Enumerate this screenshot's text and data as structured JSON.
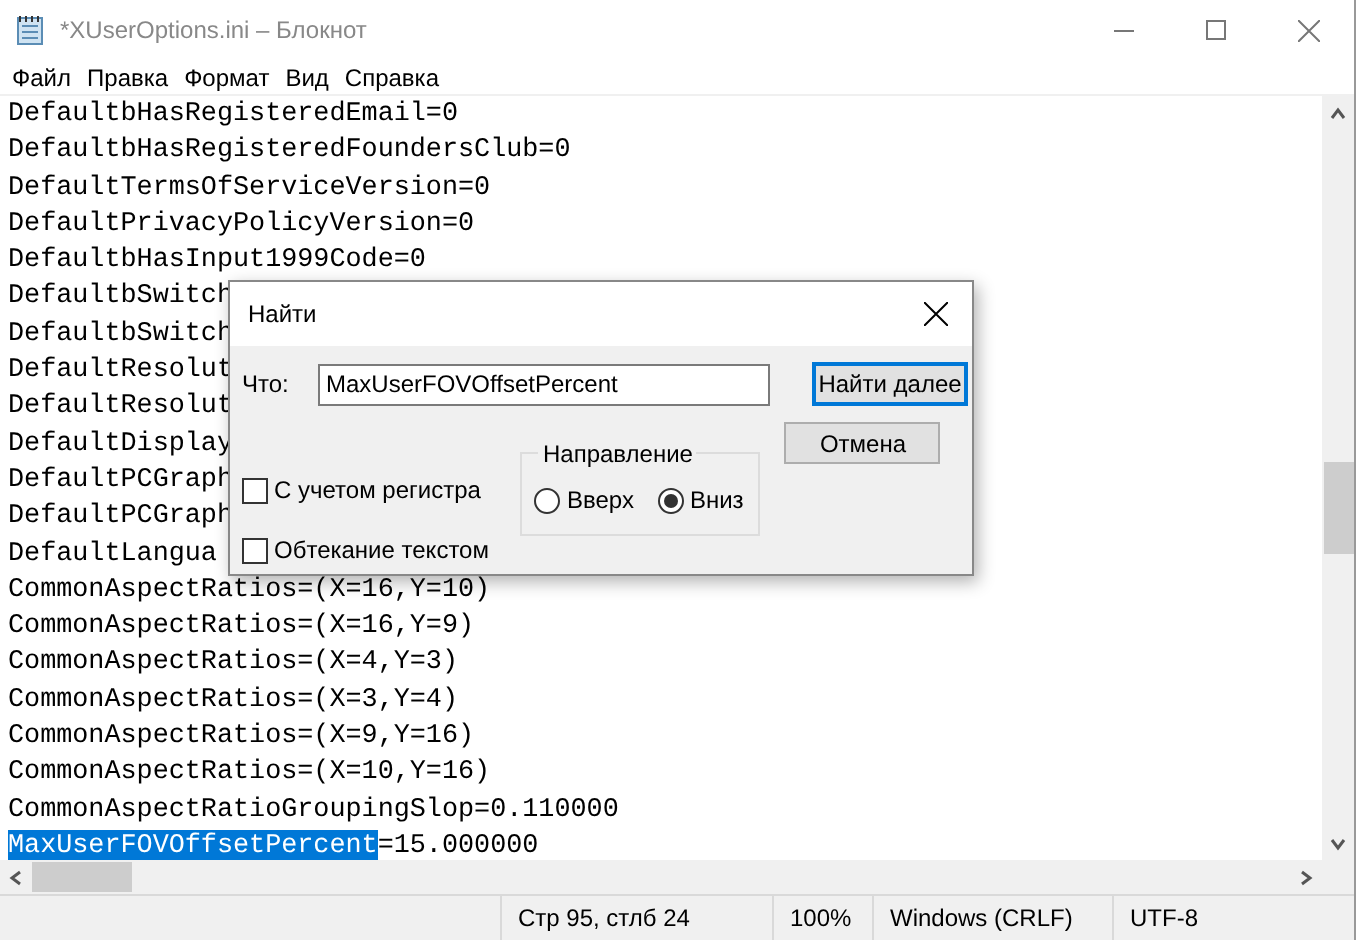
{
  "window": {
    "title": "*XUserOptions.ini – Блокнот"
  },
  "menu": [
    "Файл",
    "Правка",
    "Формат",
    "Вид",
    "Справка"
  ],
  "editor": {
    "lines": [
      {
        "text": "DefaultbHasRegisteredEmail=0"
      },
      {
        "text": "DefaultbHasRegisteredFoundersClub=0"
      },
      {
        "text": "DefaultTermsOfServiceVersion=0"
      },
      {
        "text": "DefaultPrivacyPolicyVersion=0"
      },
      {
        "text": "DefaultbHasInput1999Code=0"
      },
      {
        "text": "DefaultbSwitch"
      },
      {
        "text": "DefaultbSwitch"
      },
      {
        "text": "DefaultResolut"
      },
      {
        "text": "DefaultResolut"
      },
      {
        "text": "DefaultDisplay"
      },
      {
        "text": "DefaultPCGraph"
      },
      {
        "text": "DefaultPCGraph"
      },
      {
        "text": "DefaultLangua"
      },
      {
        "text": "CommonAspectRatios=(X=16,Y=10)"
      },
      {
        "text": "CommonAspectRatios=(X=16,Y=9)"
      },
      {
        "text": "CommonAspectRatios=(X=4,Y=3)"
      },
      {
        "text": "CommonAspectRatios=(X=3,Y=4)"
      },
      {
        "text": "CommonAspectRatios=(X=9,Y=16)"
      },
      {
        "text": "CommonAspectRatios=(X=10,Y=16)"
      },
      {
        "text": "CommonAspectRatioGroupingSlop=0.110000"
      },
      {
        "selection": "MaxUserFOVOffsetPercent",
        "text": "=15.000000"
      }
    ]
  },
  "status_bar": [
    "Стр 95, стлб 24",
    "100%",
    "Windows (CRLF)",
    "UTF-8"
  ],
  "find_dialog": {
    "title": "Найти",
    "what_label": "Что:",
    "what_value": "MaxUserFOVOffsetPercent",
    "buttons": [
      "Найти далее",
      "Отмена"
    ],
    "direction": {
      "label": "Направление",
      "options": [
        {
          "label": "Вверх",
          "selected": false
        },
        {
          "label": "Вниз",
          "selected": true
        }
      ]
    },
    "options": [
      {
        "label": "С учетом регистра",
        "checked": false
      },
      {
        "label": "Обтекание текстом",
        "checked": false
      }
    ]
  }
}
